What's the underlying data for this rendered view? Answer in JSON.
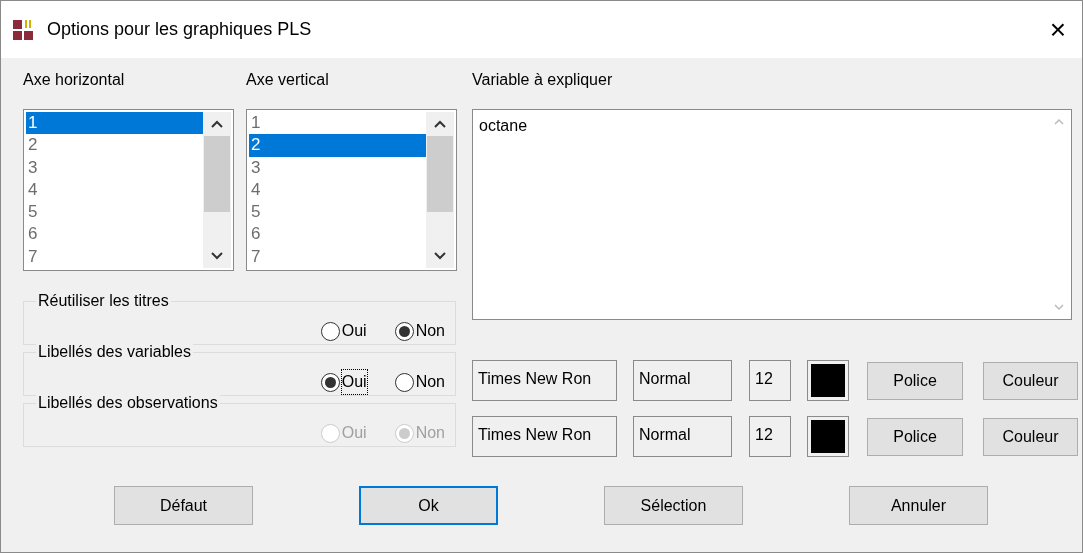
{
  "window": {
    "title": "Options pour les graphiques PLS",
    "close": "×"
  },
  "lists": [
    {
      "label": "Axe horizontal",
      "items": [
        {
          "text": "1",
          "selected": true
        },
        {
          "text": "2",
          "selected": false
        },
        {
          "text": "3",
          "selected": false
        },
        {
          "text": "4",
          "selected": false
        },
        {
          "text": "5",
          "selected": false
        },
        {
          "text": "6",
          "selected": false
        },
        {
          "text": "7",
          "selected": false
        }
      ]
    },
    {
      "label": "Axe vertical",
      "items": [
        {
          "text": "1",
          "selected": false
        },
        {
          "text": "2",
          "selected": true
        },
        {
          "text": "3",
          "selected": false
        },
        {
          "text": "4",
          "selected": false
        },
        {
          "text": "5",
          "selected": false
        },
        {
          "text": "6",
          "selected": false
        },
        {
          "text": "7",
          "selected": false
        }
      ]
    }
  ],
  "variable": {
    "label": "Variable à expliquer",
    "value": "octane"
  },
  "groups": [
    {
      "title": "Réutiliser les titres",
      "disabled": false,
      "options": [
        {
          "label": "Oui",
          "selected": false,
          "focused": false
        },
        {
          "label": "Non",
          "selected": true,
          "focused": false
        }
      ]
    },
    {
      "title": "Libellés des variables",
      "disabled": false,
      "options": [
        {
          "label": "Oui",
          "selected": true,
          "focused": true
        },
        {
          "label": "Non",
          "selected": false,
          "focused": false
        }
      ]
    },
    {
      "title": "Libellés des observations",
      "disabled": true,
      "options": [
        {
          "label": "Oui",
          "selected": false,
          "focused": false
        },
        {
          "label": "Non",
          "selected": true,
          "focused": false
        }
      ]
    }
  ],
  "font_rows": [
    {
      "font": "Times New Ron",
      "style": "Normal",
      "size": "12",
      "color": "#000000",
      "buttons": [
        "Police",
        "Couleur"
      ]
    },
    {
      "font": "Times New Ron",
      "style": "Normal",
      "size": "12",
      "color": "#000000",
      "buttons": [
        "Police",
        "Couleur"
      ]
    }
  ],
  "buttons": [
    {
      "label": "Défaut",
      "default": false
    },
    {
      "label": "Ok",
      "default": true
    },
    {
      "label": "Sélection",
      "default": false
    },
    {
      "label": "Annuler",
      "default": false
    }
  ]
}
